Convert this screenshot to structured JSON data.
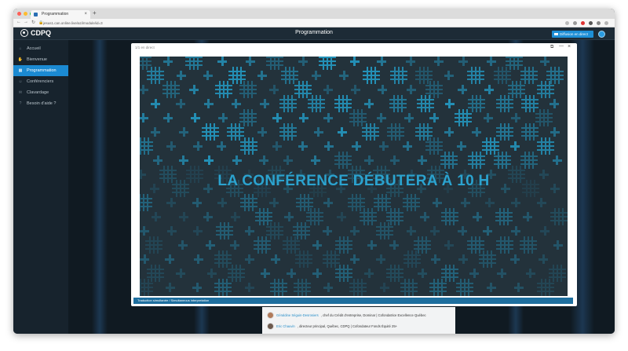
{
  "browser": {
    "tab_title": "Programmation",
    "url": "jesus1.can.online.live/azi/module/id=3",
    "close_glyph": "×",
    "new_tab_glyph": "+"
  },
  "app": {
    "logo_text": "CDPQ",
    "header_title": "Programmation",
    "live_button": "Diffusion en direct"
  },
  "sidebar": {
    "items": [
      {
        "label": "Accueil",
        "icon": "home-icon",
        "glyph": "⌂",
        "active": false
      },
      {
        "label": "Bienvenue",
        "icon": "handshake-icon",
        "glyph": "✋",
        "active": false
      },
      {
        "label": "Programmation",
        "icon": "calendar-icon",
        "glyph": "▦",
        "active": true
      },
      {
        "label": "Conférenciers",
        "icon": "speaker-icon",
        "glyph": "☺",
        "active": false
      },
      {
        "label": "Clavardage",
        "icon": "chat-icon",
        "glyph": "✉",
        "active": false
      },
      {
        "label": "Besoin d'aide ?",
        "icon": "help-icon",
        "glyph": "?",
        "active": false
      }
    ]
  },
  "modal": {
    "title": "1/1 en direct",
    "headline": "LA CONFÉRENCE DÉBUTERA À 10 H",
    "interpretation_bar": "Traduction simultanée / Simultaneous interpretation",
    "popout_glyph": "⧉",
    "minimize_glyph": "—",
    "close_glyph": "×"
  },
  "schedule": [
    {
      "name": "Géraldine Séguin-Desrosiers",
      "details": ", chef du Crédit d'entreprise, Dominar | Cofondatrice Excellence Québec"
    },
    {
      "name": "Eric Chauvin",
      "details": ", directeur principal, Québec, CDPQ | Cofondateur Fonds Équité 25+"
    }
  ],
  "colors": {
    "accent": "#1b8ad2",
    "sidebar_bg": "#17232d",
    "video_bg": "#23323b",
    "cross": "#2492b9",
    "headline": "#2ba3cf"
  }
}
